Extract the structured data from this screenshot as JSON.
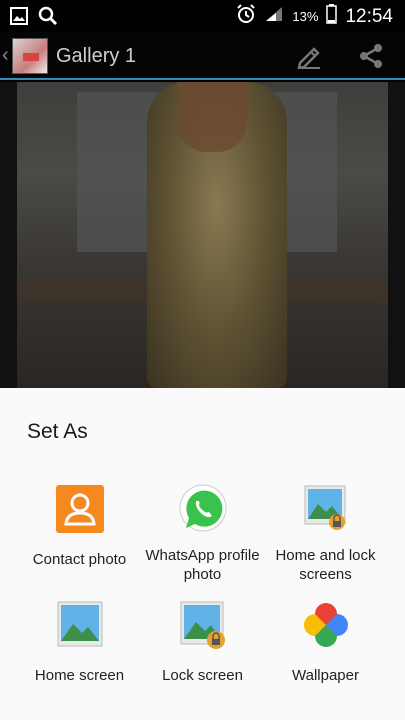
{
  "status_bar": {
    "battery_percent": "13%",
    "time": "12:54"
  },
  "action_bar": {
    "title": "Gallery 1"
  },
  "sheet": {
    "title": "Set As",
    "options": [
      {
        "label": "Contact photo",
        "icon": "contact-icon"
      },
      {
        "label": "WhatsApp profile photo",
        "icon": "whatsapp-icon"
      },
      {
        "label": "Home and lock screens",
        "icon": "home-lock-screen-icon"
      },
      {
        "label": "Home screen",
        "icon": "home-screen-icon"
      },
      {
        "label": "Lock screen",
        "icon": "lock-screen-icon"
      },
      {
        "label": "Wallpaper",
        "icon": "google-photos-icon"
      }
    ]
  },
  "colors": {
    "accent": "#2d8db5",
    "contact_orange": "#f5891f",
    "whatsapp_green": "#3ac34c"
  }
}
